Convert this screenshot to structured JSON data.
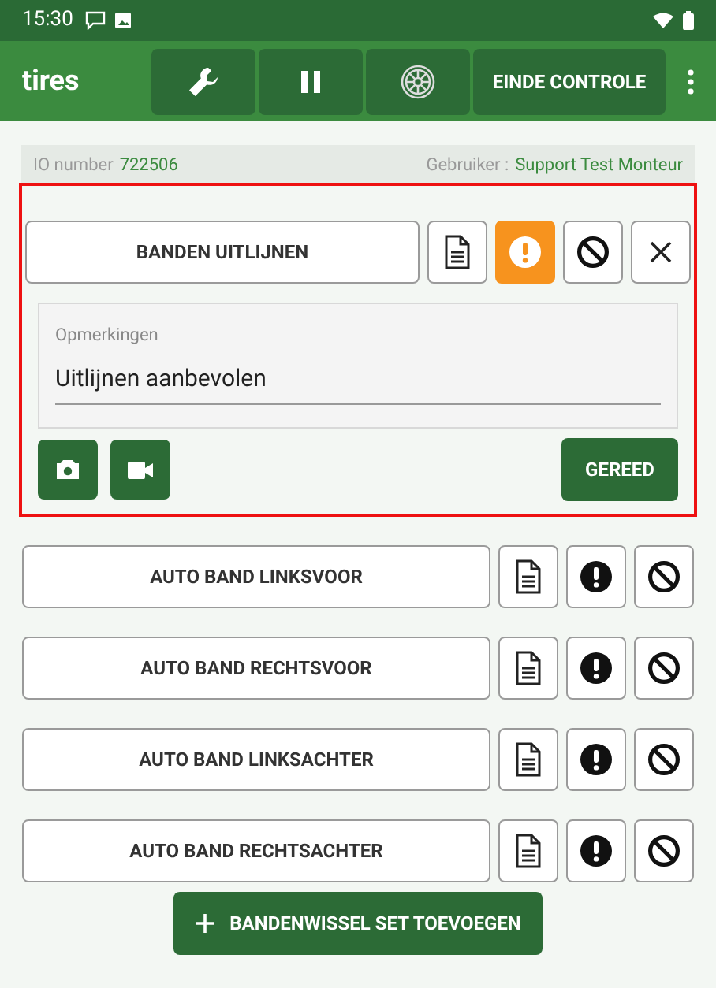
{
  "status_bar": {
    "time": "15:30"
  },
  "app_bar": {
    "title": "tires",
    "end_button": "EINDE CONTROLE"
  },
  "info": {
    "io_label": "IO number",
    "io_value": "722506",
    "user_label": "Gebruiker :",
    "user_value": "Support Test Monteur"
  },
  "items": [
    {
      "label": "BANDEN UITLIJNEN",
      "warning": true,
      "expanded": true,
      "highlighted": true,
      "remarks_label": "Opmerkingen",
      "remarks_value": "Uitlijnen aanbevolen",
      "done_button": "GEREED"
    },
    {
      "label": "AUTO BAND LINKSVOOR",
      "warning": false,
      "expanded": false,
      "highlighted": false
    },
    {
      "label": "AUTO BAND RECHTSVOOR",
      "warning": false,
      "expanded": false,
      "highlighted": false
    },
    {
      "label": "AUTO BAND LINKSACHTER",
      "warning": false,
      "expanded": false,
      "highlighted": false
    },
    {
      "label": "AUTO BAND RECHTSACHTER",
      "warning": false,
      "expanded": false,
      "highlighted": false
    }
  ],
  "add_button": "BANDENWISSEL SET TOEVOEGEN"
}
